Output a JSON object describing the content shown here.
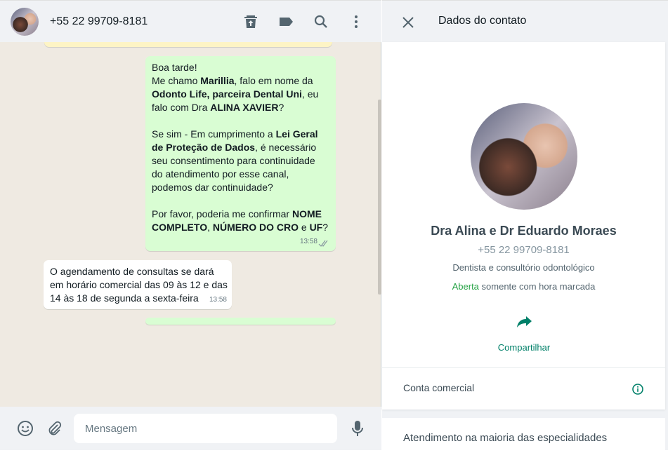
{
  "chat_header": {
    "contact_number": "+55 22 99709-8181",
    "icons": [
      "archive-icon",
      "label-icon",
      "search-icon",
      "menu-icon"
    ]
  },
  "messages": [
    {
      "direction": "outgoing",
      "time": "13:58",
      "status": "read",
      "lines": [
        [
          [
            "Boa tarde!",
            false
          ]
        ],
        [
          [
            "Me chamo ",
            false
          ],
          [
            "Marillia",
            true
          ],
          [
            ", falo em nome da",
            false
          ]
        ],
        [
          [
            "Odonto Life, parceira Dental Uni",
            true
          ],
          [
            ", eu",
            false
          ]
        ],
        [
          [
            "falo com Dra ",
            false
          ],
          [
            "ALINA XAVIER",
            true
          ],
          [
            "?",
            false
          ]
        ],
        [
          [
            "",
            false
          ]
        ],
        [
          [
            "Se sim - Em cumprimento a ",
            false
          ],
          [
            "Lei Geral",
            true
          ]
        ],
        [
          [
            "de Proteção de Dados",
            true
          ],
          [
            ", é necessário",
            false
          ]
        ],
        [
          [
            "seu consentimento para continuidade",
            false
          ]
        ],
        [
          [
            "do atendimento por esse canal,",
            false
          ]
        ],
        [
          [
            "podemos dar continuidade?",
            false
          ]
        ],
        [
          [
            "",
            false
          ]
        ],
        [
          [
            "Por favor, poderia me confirmar ",
            false
          ],
          [
            "NOME",
            true
          ]
        ],
        [
          [
            "COMPLETO",
            true
          ],
          [
            ", ",
            false
          ],
          [
            "NÚMERO DO CRO",
            true
          ],
          [
            " e ",
            false
          ],
          [
            "UF",
            true
          ],
          [
            "?",
            false
          ]
        ]
      ]
    },
    {
      "direction": "incoming",
      "time": "13:58",
      "lines": [
        [
          [
            "O agendamento de consultas se dará",
            false
          ]
        ],
        [
          [
            "em horário comercial das 09 às 12 e das",
            false
          ]
        ],
        [
          [
            "14 às 18 de segunda a sexta-feira",
            false
          ]
        ]
      ]
    }
  ],
  "composer": {
    "placeholder": "Mensagem"
  },
  "contact_panel": {
    "title": "Dados do contato",
    "name": "Dra Alina e Dr Eduardo Moraes",
    "phone": "+55 22 99709-8181",
    "category": "Dentista e consultório odontológico",
    "status_open": "Aberta",
    "status_rest": " somente com hora marcada",
    "share_label": "Compartilhar",
    "business_account_label": "Conta comercial",
    "about": "Atendimento na maioria das especialidades"
  },
  "colors": {
    "accent": "#008069",
    "open_green": "#25a244",
    "outgoing_bubble": "#d9fdd3"
  }
}
